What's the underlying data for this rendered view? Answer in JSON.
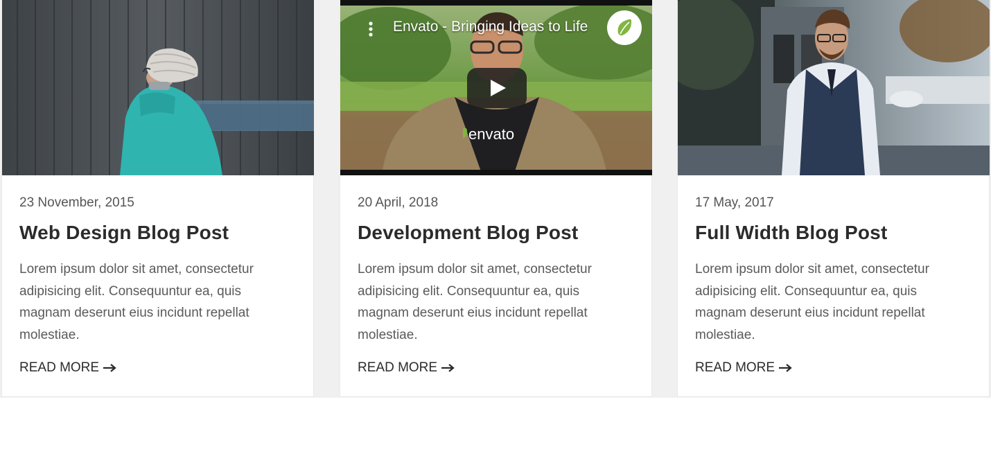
{
  "posts": [
    {
      "date": "23 November, 2015",
      "title": "Web Design Blog Post",
      "excerpt": "Lorem ipsum dolor sit amet, consectetur adipisicing elit. Consequuntur ea, quis magnam deserunt eius incidunt repellat molestiae.",
      "read_more": "READ MORE",
      "arrow_icon": "long-arrow-right-icon"
    },
    {
      "date": "20 April, 2018",
      "title": "Development Blog Post",
      "excerpt": "Lorem ipsum dolor sit amet, consectetur adipisicing elit. Consequuntur ea, quis magnam deserunt eius incidunt repellat molestiae.",
      "read_more": "READ MORE",
      "arrow_icon": "long-arrow-right-icon",
      "video": {
        "title": "Envato - Bringing Ideas to Life",
        "shirt_text": "envato",
        "menu_icon": "kebab-menu-icon",
        "play_icon": "play-icon",
        "channel_icon": "envato-leaf-icon"
      }
    },
    {
      "date": "17 May, 2017",
      "title": "Full Width Blog Post",
      "excerpt": "Lorem ipsum dolor sit amet, consectetur adipisicing elit. Consequuntur ea, quis magnam deserunt eius incidunt repellat molestiae.",
      "read_more": "READ MORE",
      "arrow_icon": "long-arrow-right-icon"
    }
  ],
  "colors": {
    "page_band": "#f0f0f0",
    "card_bg": "#ffffff",
    "title": "#2b2b2b",
    "text": "#5a5a5a",
    "envato_green": "#82b541",
    "youtube_overlay": "#1e1e1e"
  }
}
